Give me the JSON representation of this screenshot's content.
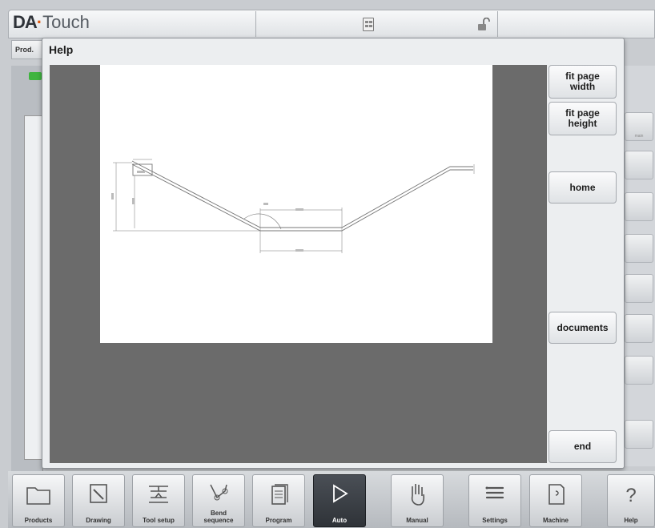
{
  "header": {
    "logo_brand": "DA",
    "logo_dot": "·",
    "logo_product": "Touch",
    "calculator_icon": "calculator-icon",
    "lock_icon": "unlocked-padlock-icon"
  },
  "left_tab": {
    "label": "Prod."
  },
  "help": {
    "title": "Help",
    "buttons": {
      "fit_width": "fit page\nwidth",
      "fit_height": "fit page\nheight",
      "home": "home",
      "documents": "documents",
      "end": "end"
    }
  },
  "right_sidebar": {
    "icons": [
      "table-icon",
      "grid-icon",
      "document-icon",
      "magnifier-icon",
      "dial-icon",
      "plus-minus-icon",
      "press-icon",
      "clock-icon"
    ]
  },
  "toolbar": {
    "items": [
      {
        "label": "Products",
        "icon": "folder-icon"
      },
      {
        "label": "Drawing",
        "icon": "pencil-icon"
      },
      {
        "label": "Tool setup",
        "icon": "tool-setup-icon"
      },
      {
        "label": "Bend\nsequence",
        "icon": "bend-sequence-icon"
      },
      {
        "label": "Program",
        "icon": "documents-icon"
      },
      {
        "label": "Auto",
        "icon": "play-icon"
      },
      {
        "label": "Manual",
        "icon": "hand-icon"
      },
      {
        "label": "Settings",
        "icon": "list-icon"
      },
      {
        "label": "Machine",
        "icon": "machine-icon"
      },
      {
        "label": "Help",
        "icon": "question-icon"
      }
    ]
  },
  "colors": {
    "active_tab": "#3a3f45",
    "viewer_bg": "#6b6b6b",
    "logo_accent": "#e05a10"
  }
}
